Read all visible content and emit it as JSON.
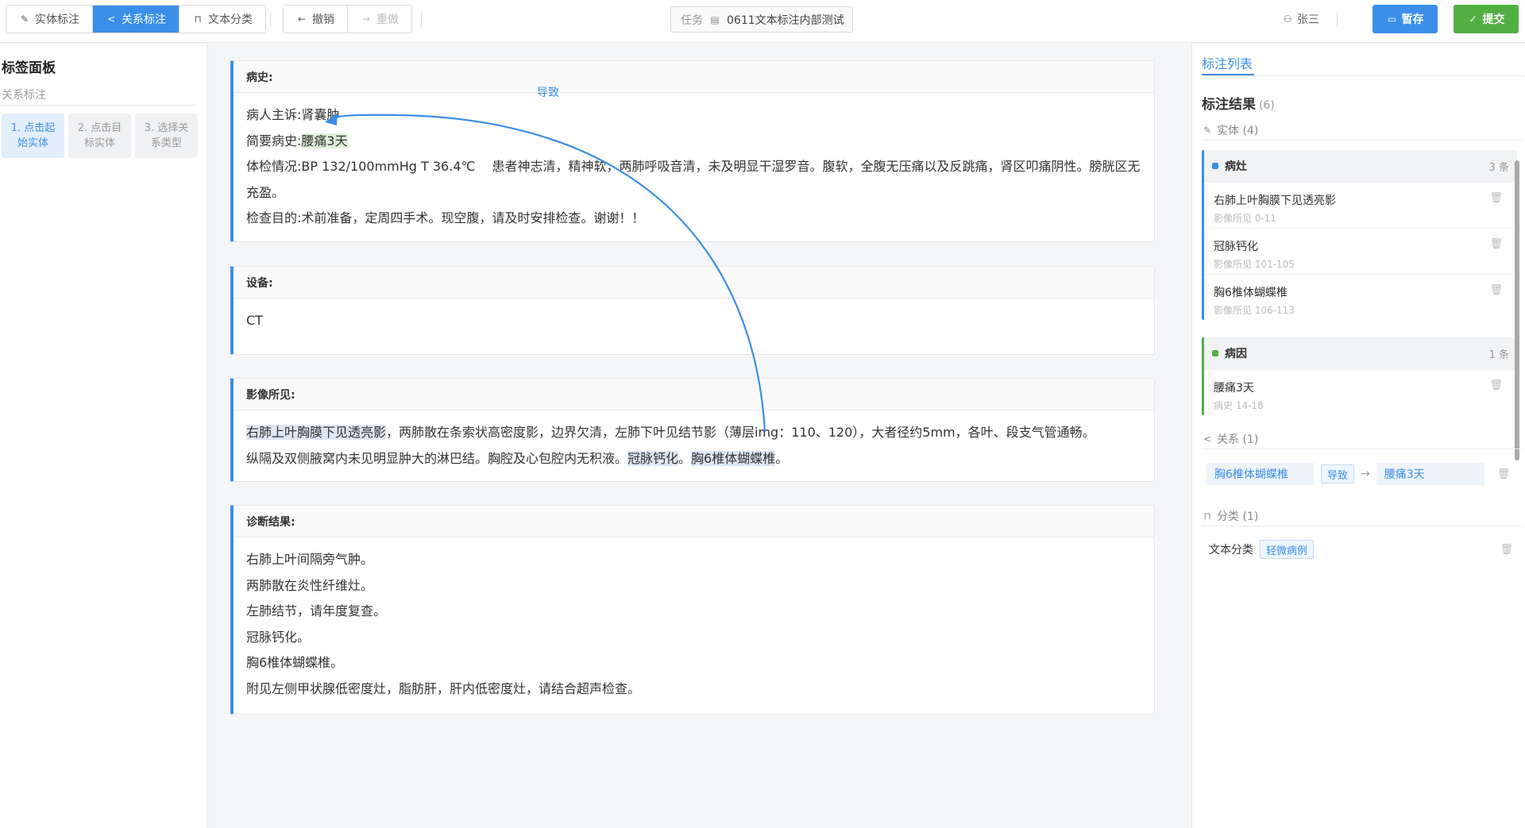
{
  "toolbar": {
    "mode_tabs": [
      {
        "label": "实体标注",
        "icon": "pencil-icon"
      },
      {
        "label": "关系标注",
        "icon": "share-icon"
      },
      {
        "label": "文本分类",
        "icon": "bookmark-icon"
      }
    ],
    "undo_label": "撤销",
    "redo_label": "重做",
    "task_label": "任务",
    "task_name": "0611文本标注内部测试",
    "user_name": "张三",
    "save_label": "暂存",
    "submit_label": "提交",
    "colors": {
      "accent": "#3b8fe8",
      "success": "#52b043"
    }
  },
  "left_panel": {
    "title": "标签面板",
    "subtitle": "关系标注",
    "steps": [
      "1. 点击起始实体",
      "2. 点击目标实体",
      "3. 选择关系类型"
    ]
  },
  "document": {
    "sections": [
      {
        "title": "病史:",
        "lines": [
          [
            "病人主诉:肾囊肿"
          ],
          [
            "简要病史:",
            "腰痛3天"
          ],
          [
            "体检情况:BP 132/100mmHg T 36.4℃　 患者神志清，精神软，两肺呼吸音清，未及明显干湿罗音。腹软，全腹无压痛以及反跳痛，肾区叩痛阴性。膀胱区无充盈。"
          ],
          [
            "检查目的:术前准备，定周四手术。现空腹，请及时安排检查。谢谢！！"
          ]
        ]
      },
      {
        "title": "设备:",
        "lines": [
          [
            "CT"
          ]
        ]
      },
      {
        "title": "影像所见:",
        "lines": [
          [
            "右肺上叶胸膜下见透亮影",
            "，两肺散在条索状高密度影，边界欠清，左肺下叶见结节影（薄层img：110、120），大者径约5mm，各叶、段支气管通畅。"
          ],
          [
            "纵隔及双侧腋窝内未见明显肿大的淋巴结。胸腔及心包腔内无积液。",
            "冠脉钙化",
            "。",
            "胸6椎体蝴蝶椎",
            "。"
          ]
        ]
      },
      {
        "title": "诊断结果:",
        "lines": [
          [
            "右肺上叶间隔旁气肿。"
          ],
          [
            "两肺散在炎性纤维灶。"
          ],
          [
            "左肺结节，请年度复查。"
          ],
          [
            "冠脉钙化。"
          ],
          [
            "胸6椎体蝴蝶椎。"
          ],
          [
            "附见左侧甲状腺低密度灶，脂肪肝，肝内低密度灶，请结合超声检查。"
          ]
        ]
      }
    ],
    "relation_arrow_label": "导致"
  },
  "right_panel": {
    "tab_label": "标注列表",
    "results_title": "标注结果",
    "results_count": "(6)",
    "entity_section": "实体 (4)",
    "groups": [
      {
        "name": "病灶",
        "count": "3 条",
        "color": "#3b8fe8",
        "items": [
          {
            "text": "右肺上叶胸膜下见透亮影",
            "meta": "影像所见 0-11"
          },
          {
            "text": "冠脉钙化",
            "meta": "影像所见 101-105"
          },
          {
            "text": "胸6椎体蝴蝶椎",
            "meta": "影像所见 106-113"
          }
        ]
      },
      {
        "name": "病因",
        "count": "1 条",
        "color": "#52b043",
        "items": [
          {
            "text": "腰痛3天",
            "meta": "病史 14-18"
          }
        ]
      }
    ],
    "relation_section": "关系 (1)",
    "relation": {
      "source": "胸6椎体蝴蝶椎",
      "type": "导致",
      "target": "腰痛3天"
    },
    "classification_section": "分类 (1)",
    "classification": {
      "label": "文本分类",
      "value": "轻微病例"
    }
  }
}
